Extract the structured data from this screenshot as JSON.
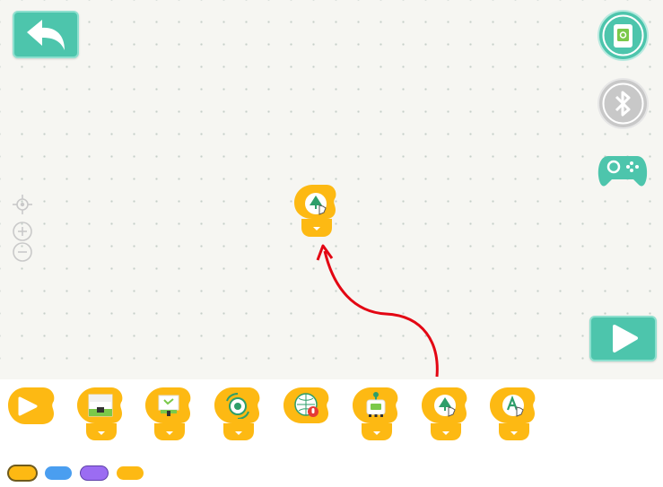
{
  "toolbar": {
    "back": {
      "icon": "back-arrow-icon",
      "color": "#4dc5ac"
    },
    "device": {
      "icon": "device-icon"
    },
    "bluetooth": {
      "icon": "bluetooth-icon"
    },
    "controller": {
      "icon": "gamepad-icon"
    },
    "run": {
      "icon": "play-icon",
      "color": "#4dc5ac"
    }
  },
  "zoom": {
    "center": "target-icon",
    "zoom_in": "zoom-in-icon",
    "zoom_out": "zoom-out-icon"
  },
  "workspace": {
    "blocks": [
      {
        "name": "press-tree-block",
        "icon": "tree-tap-icon"
      }
    ],
    "annotation": {
      "type": "arrow",
      "color": "#e30613"
    }
  },
  "palette": {
    "block_color": "#fdb913",
    "blocks": [
      {
        "name": "start-block",
        "icon": "play-icon"
      },
      {
        "name": "screen-block",
        "icon": "screen-icon"
      },
      {
        "name": "display-block",
        "icon": "display-icon"
      },
      {
        "name": "rotate-block",
        "icon": "rotate-icon"
      },
      {
        "name": "sound-block",
        "icon": "sound-icon"
      },
      {
        "name": "robot-block",
        "icon": "robot-icon"
      },
      {
        "name": "tap-tree-block",
        "icon": "tree-tap-icon"
      },
      {
        "name": "tap-letter-block",
        "icon": "letter-tap-icon"
      }
    ]
  },
  "categories": [
    {
      "name": "events",
      "color": "#fdb913",
      "selected": true
    },
    {
      "name": "motion",
      "color": "#4a9ef0",
      "selected": false
    },
    {
      "name": "looks",
      "color": "#9b6cf2",
      "selected": false
    },
    {
      "name": "control",
      "color": "#fdb913",
      "selected": false
    }
  ]
}
